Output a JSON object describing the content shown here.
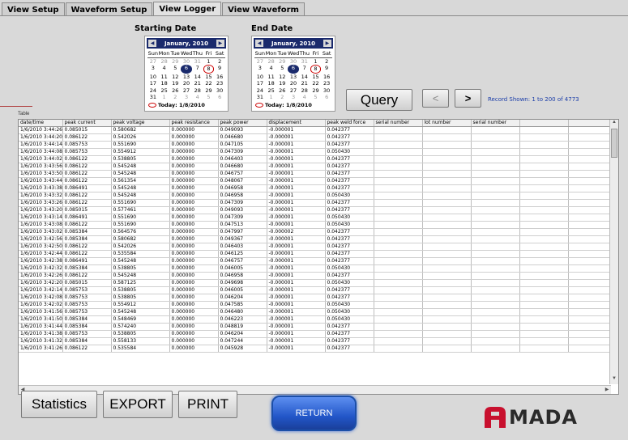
{
  "tabs": [
    "View Setup",
    "Waveform Setup",
    "View Logger",
    "View Waveform"
  ],
  "active_tab": 2,
  "start_calendar": {
    "title": "Starting Date",
    "month_label": "January, 2010",
    "today_label": "Today: 1/8/2010"
  },
  "end_calendar": {
    "title": "End Date",
    "month_label": "January, 2010",
    "today_label": "Today: 1/8/2010"
  },
  "calendar_dow": [
    "Sun",
    "Mon",
    "Tue",
    "Wed",
    "Thu",
    "Fri",
    "Sat"
  ],
  "calendar_weeks": [
    [
      "27",
      "28",
      "29",
      "30",
      "31",
      "1",
      "2"
    ],
    [
      "3",
      "4",
      "5",
      "6",
      "7",
      "8",
      "9"
    ],
    [
      "10",
      "11",
      "12",
      "13",
      "14",
      "15",
      "16"
    ],
    [
      "17",
      "18",
      "19",
      "20",
      "21",
      "22",
      "23"
    ],
    [
      "24",
      "25",
      "26",
      "27",
      "28",
      "29",
      "30"
    ],
    [
      "31",
      "1",
      "2",
      "3",
      "4",
      "5",
      "6"
    ]
  ],
  "buttons": {
    "query": "Query",
    "prev": "<",
    "next": ">",
    "statistics": "Statistics",
    "export": "EXPORT",
    "print": "PRINT",
    "return": "RETURN"
  },
  "record_shown": "Record Shown: 1 to 200 of 4773",
  "table": {
    "label": "Table",
    "columns": [
      "date/time",
      "peak current",
      "peak voltage",
      "peak resistance",
      "peak power",
      "displacement",
      "peak weld force",
      "serial number",
      "lot number",
      "serial number",
      "",
      ""
    ],
    "rows": [
      [
        "1/6/2010 3:44:26 P",
        "0.085015",
        "0.580682",
        "0.000000",
        "0.049093",
        "-0.000001",
        "0.042377"
      ],
      [
        "1/6/2010 3:44:20 P",
        "0.086122",
        "0.542026",
        "0.000000",
        "0.046680",
        "-0.000001",
        "0.042377"
      ],
      [
        "1/6/2010 3:44:14 P",
        "0.085753",
        "0.551690",
        "0.000000",
        "0.047105",
        "-0.000001",
        "0.042377"
      ],
      [
        "1/6/2010 3:44:08 P",
        "0.085753",
        "0.554912",
        "0.000000",
        "0.047309",
        "-0.000001",
        "0.050430"
      ],
      [
        "1/6/2010 3:44:02 P",
        "0.086122",
        "0.538805",
        "0.000000",
        "0.046403",
        "-0.000001",
        "0.042377"
      ],
      [
        "1/6/2010 3:43:56 P",
        "0.086122",
        "0.545248",
        "0.000000",
        "0.046680",
        "-0.000001",
        "0.042377"
      ],
      [
        "1/6/2010 3:43:50 P",
        "0.086122",
        "0.545248",
        "0.000000",
        "0.046757",
        "-0.000001",
        "0.042377"
      ],
      [
        "1/6/2010 3:43:44 P",
        "0.086122",
        "0.561354",
        "0.000000",
        "0.048067",
        "-0.000001",
        "0.042377"
      ],
      [
        "1/6/2010 3:43:38 P",
        "0.086491",
        "0.545248",
        "0.000000",
        "0.046958",
        "-0.000001",
        "0.042377"
      ],
      [
        "1/6/2010 3:43:32 P",
        "0.086122",
        "0.545248",
        "0.000000",
        "0.046958",
        "-0.000001",
        "0.050430"
      ],
      [
        "1/6/2010 3:43:26 P",
        "0.086122",
        "0.551690",
        "0.000000",
        "0.047309",
        "-0.000001",
        "0.042377"
      ],
      [
        "1/6/2010 3:43:20 P",
        "0.085015",
        "0.577461",
        "0.000000",
        "0.049093",
        "-0.000001",
        "0.042377"
      ],
      [
        "1/6/2010 3:43:14 P",
        "0.086491",
        "0.551690",
        "0.000000",
        "0.047309",
        "-0.000001",
        "0.050430"
      ],
      [
        "1/6/2010 3:43:08 P",
        "0.086122",
        "0.551690",
        "0.000000",
        "0.047513",
        "-0.000001",
        "0.050430"
      ],
      [
        "1/6/2010 3:43:02 P",
        "0.085384",
        "0.564576",
        "0.000000",
        "0.047997",
        "-0.000002",
        "0.042377"
      ],
      [
        "1/6/2010 3:42:56 P",
        "0.085384",
        "0.580682",
        "0.000000",
        "0.049367",
        "-0.000001",
        "0.042377"
      ],
      [
        "1/6/2010 3:42:50 P",
        "0.086122",
        "0.542026",
        "0.000000",
        "0.046403",
        "-0.000001",
        "0.042377"
      ],
      [
        "1/6/2010 3:42:44 P",
        "0.086122",
        "0.535584",
        "0.000000",
        "0.046125",
        "-0.000001",
        "0.042377"
      ],
      [
        "1/6/2010 3:42:38 P",
        "0.086491",
        "0.545248",
        "0.000000",
        "0.046757",
        "-0.000001",
        "0.042377"
      ],
      [
        "1/6/2010 3:42:32 P",
        "0.085384",
        "0.538805",
        "0.000000",
        "0.046005",
        "-0.000001",
        "0.050430"
      ],
      [
        "1/6/2010 3:42:26 P",
        "0.086122",
        "0.545248",
        "0.000000",
        "0.046958",
        "-0.000001",
        "0.042377"
      ],
      [
        "1/6/2010 3:42:20 P",
        "0.085015",
        "0.587125",
        "0.000000",
        "0.049698",
        "-0.000001",
        "0.050430"
      ],
      [
        "1/6/2010 3:42:14 P",
        "0.085753",
        "0.538805",
        "0.000000",
        "0.046005",
        "-0.000001",
        "0.042377"
      ],
      [
        "1/6/2010 3:42:08 P",
        "0.085753",
        "0.538805",
        "0.000000",
        "0.046204",
        "-0.000001",
        "0.042377"
      ],
      [
        "1/6/2010 3:42:02 P",
        "0.085753",
        "0.554912",
        "0.000000",
        "0.047585",
        "-0.000001",
        "0.050430"
      ],
      [
        "1/6/2010 3:41:56 P",
        "0.085753",
        "0.545248",
        "0.000000",
        "0.046480",
        "-0.000001",
        "0.050430"
      ],
      [
        "1/6/2010 3:41:50 P",
        "0.085384",
        "0.548469",
        "0.000000",
        "0.046223",
        "-0.000001",
        "0.050430"
      ],
      [
        "1/6/2010 3:41:44 P",
        "0.085384",
        "0.574240",
        "0.000000",
        "0.048819",
        "-0.000001",
        "0.042377"
      ],
      [
        "1/6/2010 3:41:38 P",
        "0.085753",
        "0.538805",
        "0.000000",
        "0.046204",
        "-0.000001",
        "0.042377"
      ],
      [
        "1/6/2010 3:41:32 P",
        "0.085384",
        "0.558133",
        "0.000000",
        "0.047244",
        "-0.000001",
        "0.042377"
      ],
      [
        "1/6/2010 3:41:26 P",
        "0.086122",
        "0.535584",
        "0.000000",
        "0.045928",
        "-0.000001",
        "0.042377"
      ]
    ]
  },
  "logo_text": "MADA",
  "colors": {
    "calendar_header": "#1a2a6c",
    "return_button": "#2256c8",
    "record_label": "#1a3ca8",
    "logo_red": "#c8102e"
  }
}
